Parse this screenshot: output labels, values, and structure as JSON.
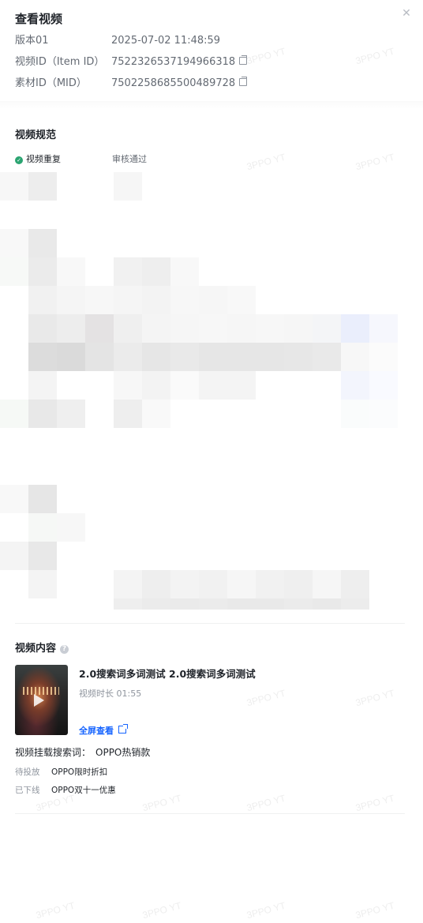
{
  "header": {
    "title": "查看视频",
    "close_icon": "close-icon"
  },
  "info": {
    "version_label": "版本01",
    "version_time": "2025-07-02 11:48:59",
    "item_id_label": "视频ID（Item ID）",
    "item_id_value": "7522326537194966318",
    "mid_label": "素材ID（MID）",
    "mid_value": "7502258685500489728"
  },
  "spec": {
    "section_title": "视频规范",
    "check_label": "视频重复",
    "check_status": "审核通过",
    "status_color": "#2ba471"
  },
  "content": {
    "section_title": "视频内容",
    "help_glyph": "?",
    "video_title": "2.0搜索词多词测试 2.0搜索词多词测试",
    "duration": "视频时长 01:55",
    "fullscreen_label": "全屏查看",
    "keyword_line_label": "视频挂载搜索词：",
    "keyword_line_value": "OPPO热销款",
    "keywords": [
      {
        "status": "待投放",
        "keyword": "OPPO限时折扣"
      },
      {
        "status": "已下线",
        "keyword": "OPPO双十一优惠"
      }
    ],
    "link_color": "#1664ff"
  },
  "watermark_text": "3PPO YT"
}
